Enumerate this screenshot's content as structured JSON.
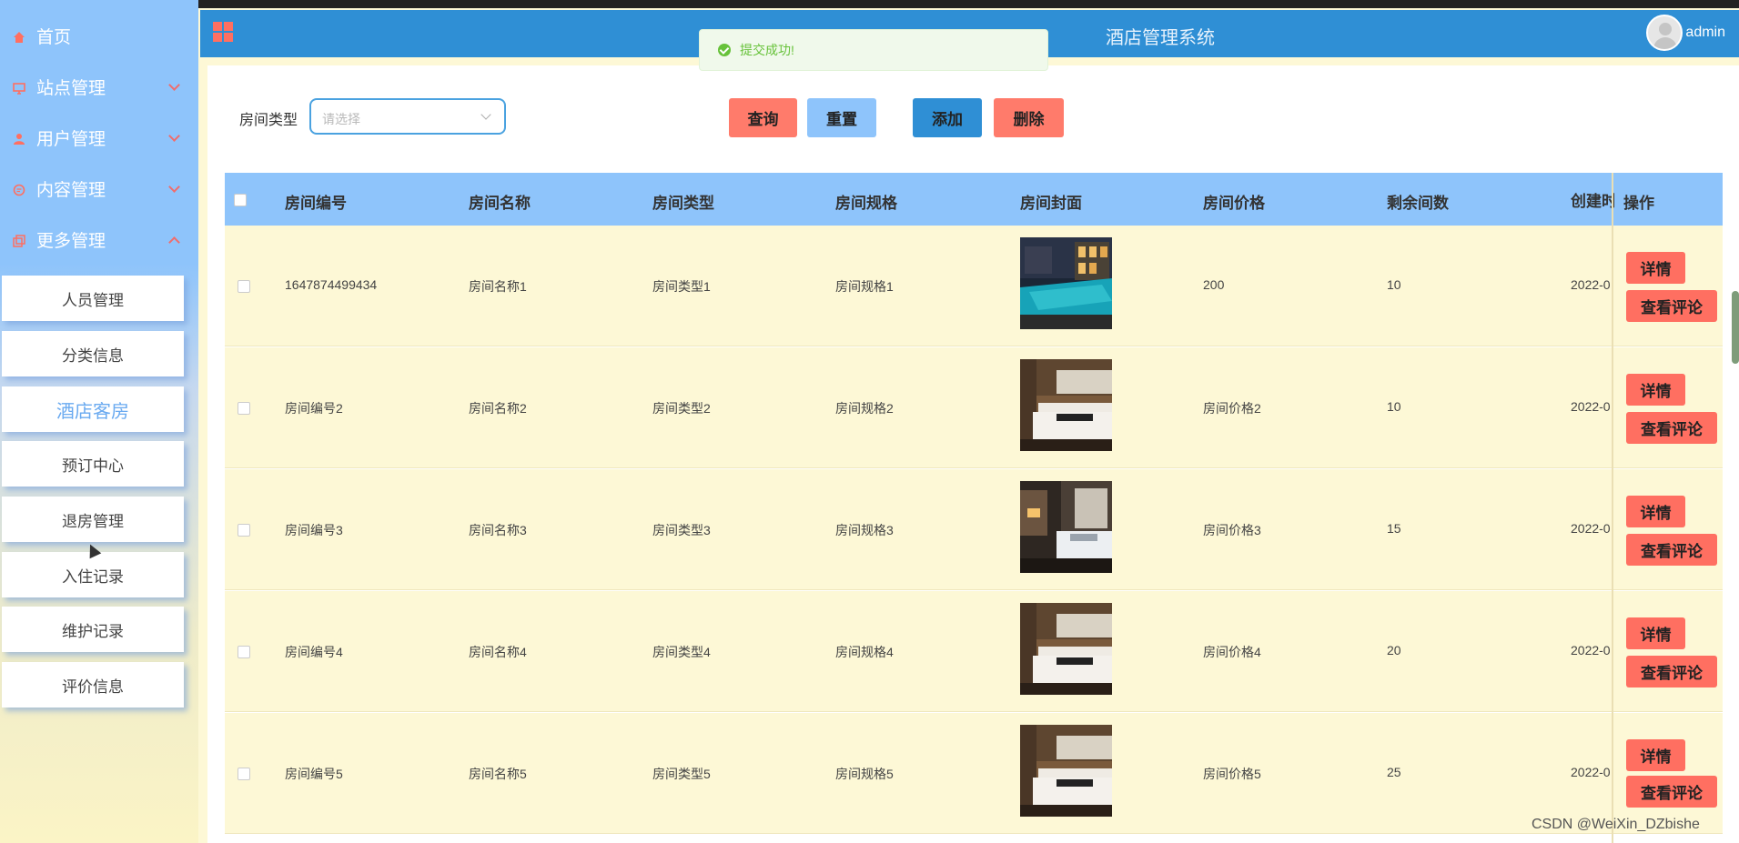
{
  "sidebar": {
    "menu": [
      {
        "label": "首页",
        "icon": "home-icon",
        "expanded": null
      },
      {
        "label": "站点管理",
        "icon": "monitor-icon",
        "expanded": false
      },
      {
        "label": "用户管理",
        "icon": "user-icon",
        "expanded": false
      },
      {
        "label": "内容管理",
        "icon": "chat-icon",
        "expanded": false
      },
      {
        "label": "更多管理",
        "icon": "copy-icon",
        "expanded": true
      }
    ],
    "submenu": [
      {
        "label": "人员管理"
      },
      {
        "label": "分类信息"
      },
      {
        "label": "酒店客房",
        "active": true
      },
      {
        "label": "预订中心"
      },
      {
        "label": "退房管理"
      },
      {
        "label": "入住记录"
      },
      {
        "label": "维护记录"
      },
      {
        "label": "评价信息"
      }
    ]
  },
  "header": {
    "title": "酒店管理系统",
    "user": "admin"
  },
  "toast": {
    "message": "提交成功!",
    "type": "success"
  },
  "filter": {
    "label": "房间类型",
    "placeholder": "请选择"
  },
  "buttons": {
    "query": "查询",
    "reset": "重置",
    "add": "添加",
    "delete": "删除"
  },
  "table": {
    "columns": [
      "房间编号",
      "房间名称",
      "房间类型",
      "房间规格",
      "房间封面",
      "房间价格",
      "剩余间数",
      "创建时间",
      "操作"
    ],
    "rows": [
      {
        "no": "1647874499434",
        "name": "房间名称1",
        "type": "房间类型1",
        "spec": "房间规格1",
        "cover": "pool-photo",
        "price": "200",
        "remain": "10",
        "created": "2022-0"
      },
      {
        "no": "房间编号2",
        "name": "房间名称2",
        "type": "房间类型2",
        "spec": "房间规格2",
        "cover": "bedroom-photo",
        "price": "房间价格2",
        "remain": "10",
        "created": "2022-0"
      },
      {
        "no": "房间编号3",
        "name": "房间名称3",
        "type": "房间类型3",
        "spec": "房间规格3",
        "cover": "bedroom-photo",
        "price": "房间价格3",
        "remain": "15",
        "created": "2022-0"
      },
      {
        "no": "房间编号4",
        "name": "房间名称4",
        "type": "房间类型4",
        "spec": "房间规格4",
        "cover": "bedroom-photo",
        "price": "房间价格4",
        "remain": "20",
        "created": "2022-0"
      },
      {
        "no": "房间编号5",
        "name": "房间名称5",
        "type": "房间类型5",
        "spec": "房间规格5",
        "cover": "bedroom-photo",
        "price": "房间价格5",
        "remain": "25",
        "created": "2022-0"
      }
    ],
    "row_actions": {
      "detail": "详情",
      "comments": "查看评论"
    }
  },
  "watermark": "CSDN @WeiXin_DZbishe",
  "colors": {
    "header": "#2f8fd5",
    "sidebar": "#8ec4fb",
    "accent_red": "#ff6f61",
    "table_row": "#fdf8d6",
    "toast_green": "#67c23a"
  }
}
